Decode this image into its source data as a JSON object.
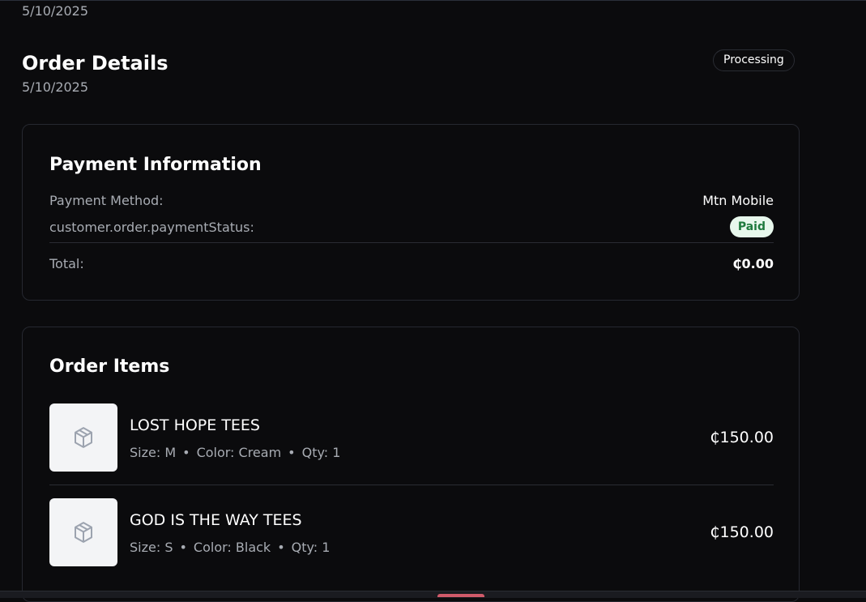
{
  "header": {
    "top_date": "5/10/2025",
    "title": "Order Details",
    "date": "5/10/2025",
    "status": "Processing"
  },
  "payment": {
    "title": "Payment Information",
    "method_label": "Payment Method:",
    "method_value": "Mtn Mobile",
    "status_label": "customer.order.paymentStatus:",
    "status_value": "Paid",
    "total_label": "Total:",
    "total_value": "₵0.00"
  },
  "items": {
    "title": "Order Items",
    "list": [
      {
        "name": "LOST HOPE TEES",
        "size": "Size: M",
        "color": "Color: Cream",
        "qty": "Qty: 1",
        "price": "₵150.00"
      },
      {
        "name": "GOD IS THE WAY TEES",
        "size": "Size: S",
        "color": "Color: Black",
        "qty": "Qty: 1",
        "price": "₵150.00"
      }
    ],
    "bullet": "•",
    "thumb_icon": "package-icon"
  },
  "colors": {
    "background": "#0b0b0d",
    "muted_text": "#a8acb3",
    "paid_bg": "#e7f7ec",
    "paid_text": "#1f7a3e"
  }
}
